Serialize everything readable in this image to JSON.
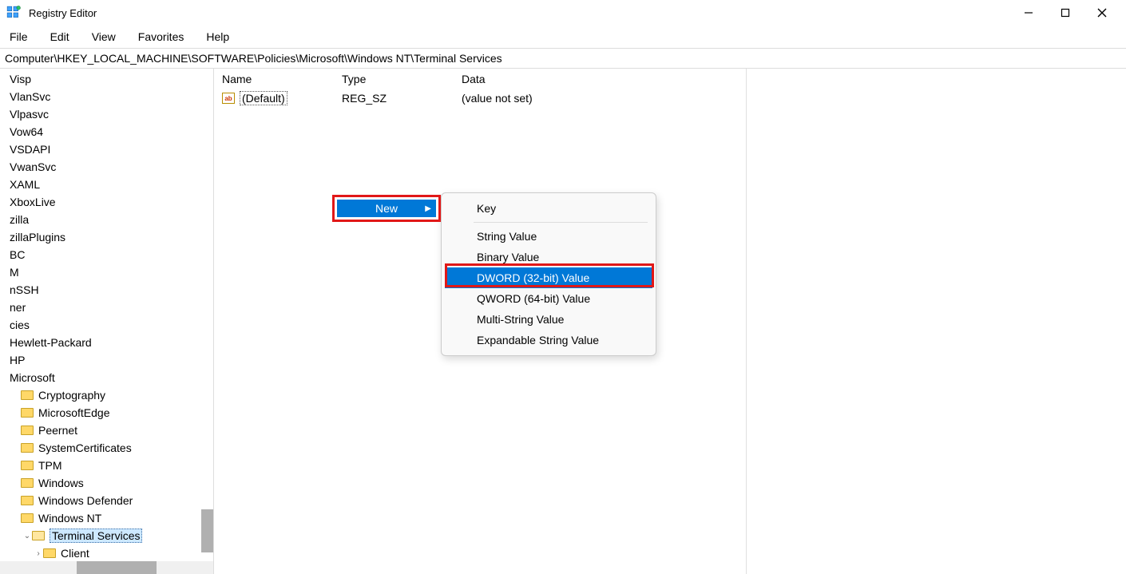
{
  "app": {
    "title": "Registry Editor"
  },
  "menu": [
    "File",
    "Edit",
    "View",
    "Favorites",
    "Help"
  ],
  "address": "Computer\\HKEY_LOCAL_MACHINE\\SOFTWARE\\Policies\\Microsoft\\Windows NT\\Terminal Services",
  "tree": [
    {
      "label": "Visp",
      "indent": 0,
      "folder": false
    },
    {
      "label": "VlanSvc",
      "indent": 0,
      "folder": false
    },
    {
      "label": "Vlpasvc",
      "indent": 0,
      "folder": false
    },
    {
      "label": "Vow64",
      "indent": 0,
      "folder": false
    },
    {
      "label": "VSDAPI",
      "indent": 0,
      "folder": false
    },
    {
      "label": "VwanSvc",
      "indent": 0,
      "folder": false
    },
    {
      "label": "XAML",
      "indent": 0,
      "folder": false
    },
    {
      "label": "XboxLive",
      "indent": 0,
      "folder": false
    },
    {
      "label": "zilla",
      "indent": 0,
      "folder": false
    },
    {
      "label": "zillaPlugins",
      "indent": 0,
      "folder": false
    },
    {
      "label": "BC",
      "indent": 0,
      "folder": false
    },
    {
      "label": "M",
      "indent": 0,
      "folder": false
    },
    {
      "label": "nSSH",
      "indent": 0,
      "folder": false
    },
    {
      "label": "ner",
      "indent": 0,
      "folder": false
    },
    {
      "label": "cies",
      "indent": 0,
      "folder": false
    },
    {
      "label": "Hewlett-Packard",
      "indent": 0,
      "folder": false
    },
    {
      "label": "HP",
      "indent": 0,
      "folder": false
    },
    {
      "label": "Microsoft",
      "indent": 0,
      "folder": false
    },
    {
      "label": "Cryptography",
      "indent": 1,
      "folder": true
    },
    {
      "label": "MicrosoftEdge",
      "indent": 1,
      "folder": true
    },
    {
      "label": "Peernet",
      "indent": 1,
      "folder": true
    },
    {
      "label": "SystemCertificates",
      "indent": 1,
      "folder": true
    },
    {
      "label": "TPM",
      "indent": 1,
      "folder": true
    },
    {
      "label": "Windows",
      "indent": 1,
      "folder": true
    },
    {
      "label": "Windows Defender",
      "indent": 1,
      "folder": true
    },
    {
      "label": "Windows NT",
      "indent": 1,
      "folder": true
    },
    {
      "label": "Terminal Services",
      "indent": 2,
      "folder": true,
      "open": true,
      "selected": true,
      "expander": "v"
    },
    {
      "label": "Client",
      "indent": 3,
      "folder": true,
      "expander": ">"
    }
  ],
  "columns": {
    "name": "Name",
    "type": "Type",
    "data": "Data"
  },
  "values": [
    {
      "name": "(Default)",
      "type": "REG_SZ",
      "data": "(value not set)"
    }
  ],
  "context1": {
    "new": "New"
  },
  "context2": [
    {
      "label": "Key",
      "sep_after": true
    },
    {
      "label": "String Value"
    },
    {
      "label": "Binary Value"
    },
    {
      "label": "DWORD (32-bit) Value",
      "selected": true,
      "red": true
    },
    {
      "label": "QWORD (64-bit) Value"
    },
    {
      "label": "Multi-String Value"
    },
    {
      "label": "Expandable String Value"
    }
  ]
}
